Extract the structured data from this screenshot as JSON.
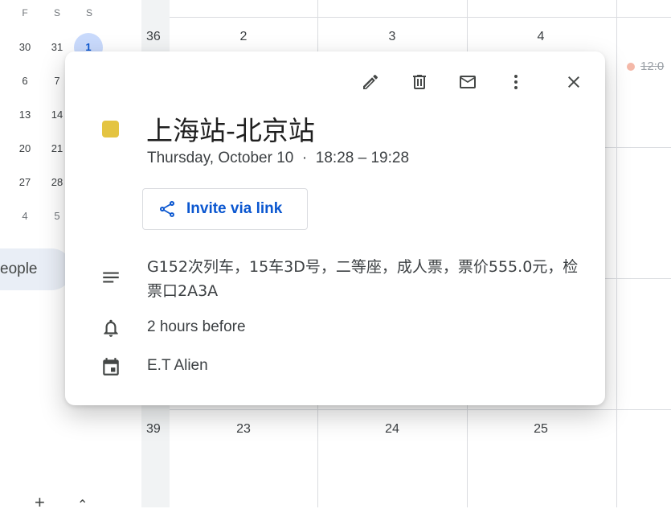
{
  "mini_calendar": {
    "weekday_headers": [
      "F",
      "S",
      "S"
    ],
    "rows": [
      [
        "30",
        "31",
        "1"
      ],
      [
        "6",
        "7",
        ""
      ],
      [
        "13",
        "14",
        ""
      ],
      [
        "20",
        "21",
        ""
      ],
      [
        "27",
        "28",
        ""
      ],
      [
        "4",
        "5",
        ""
      ]
    ],
    "people_label": "eople"
  },
  "week_grid": {
    "week_numbers": [
      "36",
      "39"
    ],
    "top_days": [
      "2",
      "3",
      "4"
    ],
    "bottom_days": [
      "23",
      "24",
      "25"
    ],
    "side_event_time": "12:0"
  },
  "event": {
    "title": "上海站-北京站",
    "date_line": "Thursday, October 10  ·  18:28 – 19:28",
    "color": "#e4c441",
    "invite_label": "Invite via link",
    "description": "G152次列车，15车3D号，二等座，成人票，票价555.0元，检票口2A3A",
    "reminder": "2 hours before",
    "calendar_owner": "E.T Alien"
  },
  "toolbar": {
    "icons": [
      "edit-icon",
      "delete-icon",
      "email-icon",
      "more-vert-icon",
      "close-icon"
    ]
  }
}
